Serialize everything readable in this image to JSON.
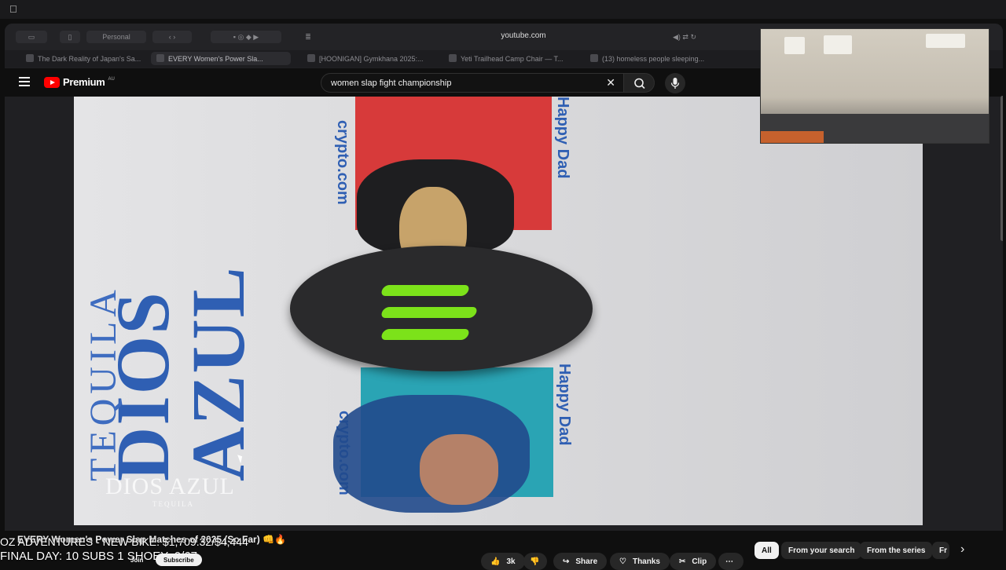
{
  "browser": {
    "profile_label": "Personal",
    "url": "youtube.com"
  },
  "tabs": [
    {
      "label": "The Dark Reality of Japan's Sa..."
    },
    {
      "label": "EVERY Women's Power Sla..."
    },
    {
      "label": "[HOONIGAN] Gymkhana 2025:..."
    },
    {
      "label": "Yeti Trailhead Camp Chair — T..."
    },
    {
      "label": "(13) homeless people sleeping..."
    }
  ],
  "youtube": {
    "logo_text": "Premium",
    "country_code": "AU",
    "search_query": "women slap fight championship"
  },
  "video": {
    "brand_text": "DIOS AZUL",
    "brand_sub": "TEQUILA",
    "sponsor_text": "crypto.com",
    "panel_text": "Happy Dad",
    "watermark_main": "DIOS AZUL",
    "watermark_sub": "TEQUILA"
  },
  "meta": {
    "title": "EVERY Women's Power Slap Matches of 2025 (So Far) 👊🔥",
    "overlay_line1": "OZ ADVENTURES - NEW BIKE: $1,709.32/$4,444",
    "overlay_line2": "FINAL DAY: 10 SUBS 1 SHOEY: 0/67",
    "join_label": "Join",
    "subscribe_label": "Subscribe",
    "like_count": "3k",
    "share_label": "Share",
    "thanks_label": "Thanks",
    "clip_label": "Clip"
  },
  "chips": [
    {
      "label": "All",
      "active": true
    },
    {
      "label": "From your search",
      "active": false
    },
    {
      "label": "From the series",
      "active": false
    },
    {
      "label": "Fr",
      "active": false
    }
  ],
  "colors": {
    "yt_red": "#ff0000",
    "monster_green": "#7ce21a",
    "brand_blue": "#2f5fb3"
  }
}
